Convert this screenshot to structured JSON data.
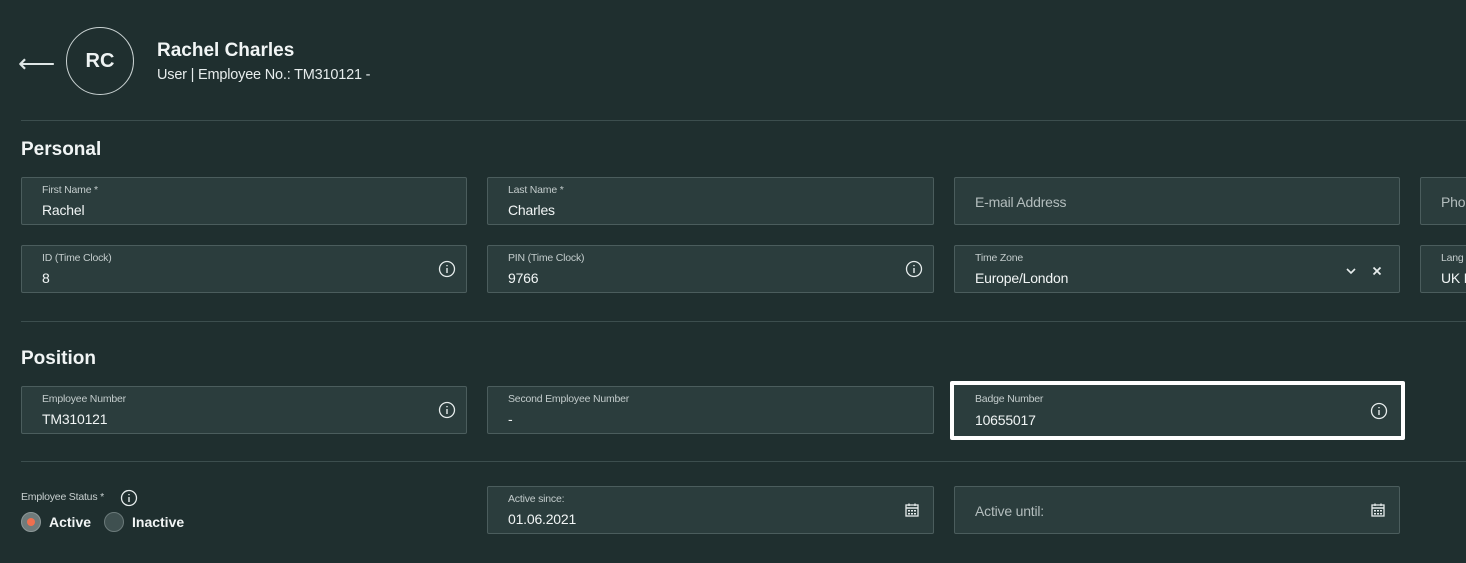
{
  "header": {
    "back_icon": "arrow-left-icon",
    "avatar_initials": "RC",
    "name": "Rachel Charles",
    "subtitle": "User | Employee No.: TM310121 -"
  },
  "personal": {
    "title": "Personal",
    "first_name": {
      "label": "First Name *",
      "value": "Rachel"
    },
    "last_name": {
      "label": "Last Name *",
      "value": "Charles"
    },
    "email": {
      "placeholder": "E-mail Address"
    },
    "phone": {
      "placeholder": "Pho"
    },
    "id_time_clock": {
      "label": "ID (Time Clock)",
      "value": "8",
      "icon": "info-icon"
    },
    "pin_time_clock": {
      "label": "PIN (Time Clock)",
      "value": "9766",
      "icon": "info-icon"
    },
    "time_zone": {
      "label": "Time Zone",
      "value": "Europe/London",
      "dropdown_icon": "chevron-down-icon",
      "clear_icon": "close-icon"
    },
    "language": {
      "label": "Lang",
      "value": "UK E"
    }
  },
  "position": {
    "title": "Position",
    "employee_number": {
      "label": "Employee Number",
      "value": "TM310121",
      "icon": "info-icon"
    },
    "second_employee_number": {
      "label": "Second Employee Number",
      "value": "-"
    },
    "badge_number": {
      "label": "Badge Number",
      "value": "10655017",
      "icon": "info-icon"
    }
  },
  "status": {
    "label": "Employee Status *",
    "options": [
      {
        "label": "Active",
        "selected": true
      },
      {
        "label": "Inactive",
        "selected": false
      }
    ],
    "active_since": {
      "label": "Active since:",
      "value": "01.06.2021",
      "icon": "calendar-icon"
    },
    "active_until": {
      "placeholder": "Active until:",
      "icon": "calendar-icon"
    }
  },
  "colors": {
    "background": "#1f2f2f",
    "field_bg": "#2b3d3d",
    "radio_accent": "#ef6f4f",
    "highlight_border": "#ffffff"
  }
}
